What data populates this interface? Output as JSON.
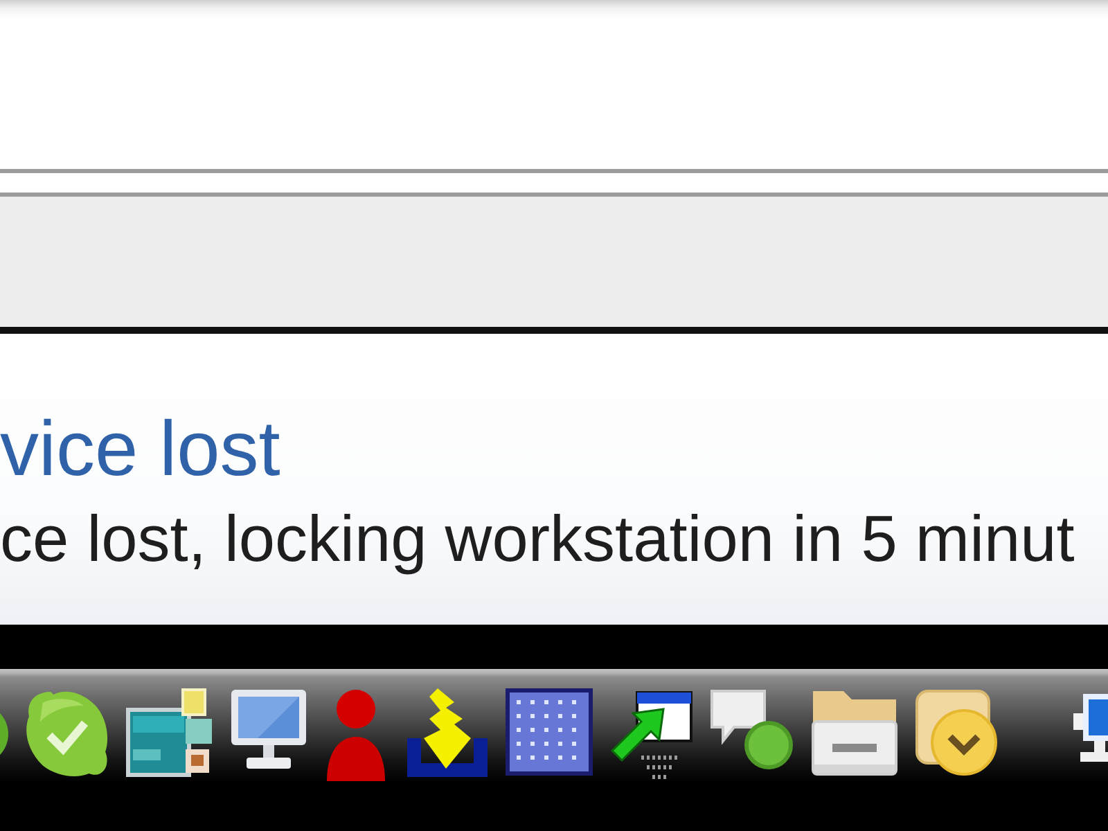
{
  "notification": {
    "title": "vice lost",
    "message": "ce lost, locking workstation in 5 minut"
  }
}
